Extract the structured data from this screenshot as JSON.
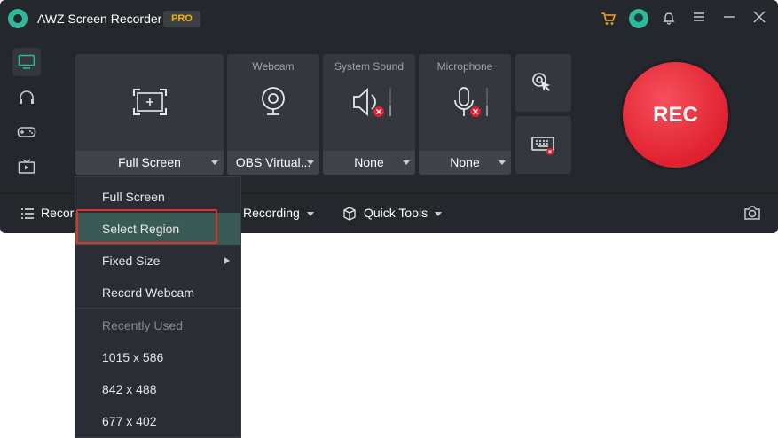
{
  "app": {
    "title": "AWZ Screen Recorder",
    "badge": "PRO"
  },
  "capture": {
    "area_value": "Full Screen",
    "webcam": {
      "label": "Webcam",
      "value": "OBS Virtual..."
    },
    "system_sound": {
      "label": "System Sound",
      "value": "None"
    },
    "microphone": {
      "label": "Microphone",
      "value": "None"
    },
    "rec_label": "REC"
  },
  "bottombar": {
    "record_label": "Record",
    "recording_label": "Recording",
    "quick_tools_label": "Quick Tools"
  },
  "menu": {
    "items": [
      {
        "label": "Full Screen"
      },
      {
        "label": "Select Region"
      },
      {
        "label": "Fixed Size"
      },
      {
        "label": "Record Webcam"
      },
      {
        "label": "Recently Used"
      },
      {
        "label": "1015 x 586"
      },
      {
        "label": "842 x 488"
      },
      {
        "label": "677 x 402"
      }
    ]
  },
  "colors": {
    "accent": "#2fb99b",
    "rec": "#e1212f",
    "badge": "#f0b400",
    "highlight_border": "#e03030"
  },
  "icons": [
    "cart-icon",
    "user-avatar-icon",
    "bell-icon",
    "menu-icon",
    "minimize-icon",
    "close-icon",
    "monitor-icon",
    "headphones-icon",
    "gamepad-icon",
    "tv-icon",
    "screen-capture-icon",
    "webcam-icon",
    "speaker-muted-icon",
    "microphone-muted-icon",
    "cursor-click-icon",
    "keyboard-icon",
    "list-icon",
    "cube-icon",
    "camera-icon"
  ]
}
